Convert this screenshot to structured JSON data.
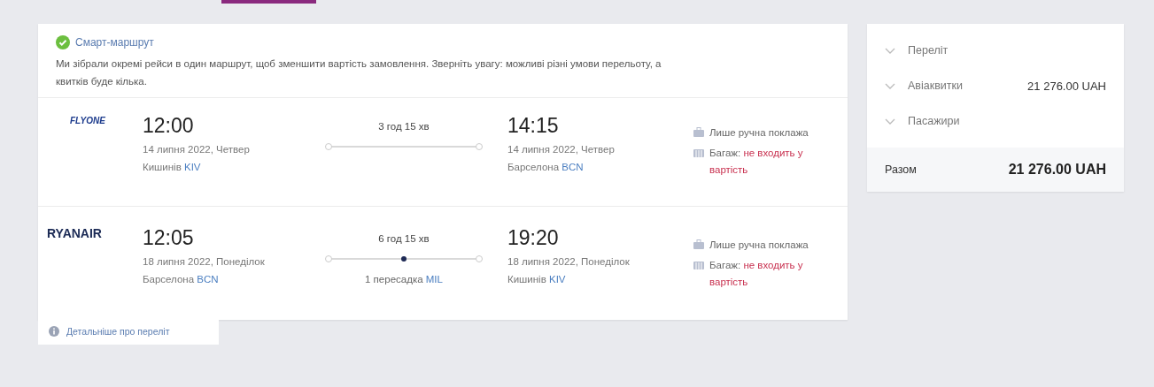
{
  "smart_route": {
    "title": "Смарт-маршрут",
    "description": "Ми зібрали окремі рейси в один маршрут, щоб зменшити вартість замовлення. Зверніть увагу: можливі різні умови перельоту, а квитків буде кілька."
  },
  "flights": [
    {
      "airline_logo": "FLYONE",
      "dep_time": "12:00",
      "dep_date": "14 липня 2022, Четвер",
      "dep_city": "Кишинів",
      "dep_code": "KIV",
      "duration": "3 год 15 хв",
      "arr_time": "14:15",
      "arr_date": "14 липня 2022, Четвер",
      "arr_city": "Барселона",
      "arr_code": "BCN",
      "hand_luggage": "Лише ручна поклажа",
      "baggage_label": "Багаж:",
      "baggage_value": "не входить у вартість"
    },
    {
      "airline_logo": "RYANAIR",
      "dep_time": "12:05",
      "dep_date": "18 липня 2022, Понеділок",
      "dep_city": "Барселона",
      "dep_code": "BCN",
      "duration": "6 год 15 хв",
      "stops_label": "1 пересадка",
      "stops_code": "MIL",
      "arr_time": "19:20",
      "arr_date": "18 липня 2022, Понеділок",
      "arr_city": "Кишинів",
      "arr_code": "KIV",
      "hand_luggage": "Лише ручна поклажа",
      "baggage_label": "Багаж:",
      "baggage_value": "не входить у вартість"
    }
  ],
  "details_link": "Детальніше про переліт",
  "summary": {
    "items": [
      {
        "label": "Переліт",
        "expanded": false
      },
      {
        "label": "Авіаквитки",
        "value": "21 276.00 UAH",
        "expanded": false
      },
      {
        "label": "Пасажири",
        "expanded": false
      }
    ],
    "total_label": "Разом",
    "total_value": "21 276.00 UAH"
  }
}
